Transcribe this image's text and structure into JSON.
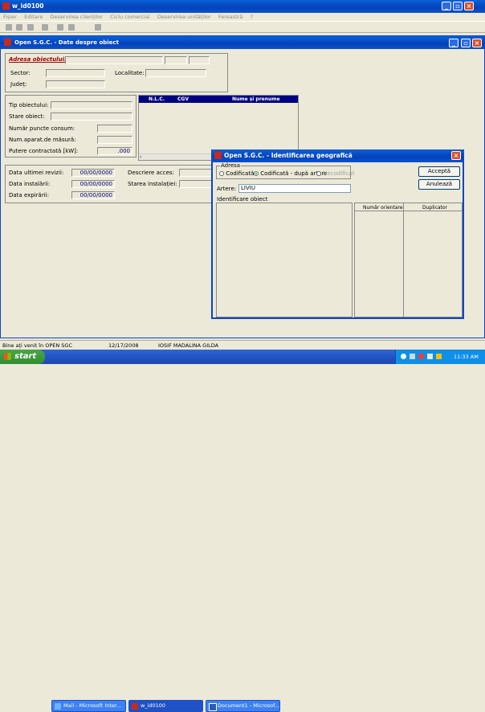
{
  "app": {
    "title": "w_id0100",
    "menu": [
      "Fișier",
      "Editare",
      "Deservirea clienților",
      "Ciclu comercial",
      "Deservirea unităților",
      "Fereastră",
      "?"
    ]
  },
  "child": {
    "title": "Open S.G.C. - Date despre obiect",
    "address": {
      "label": "Adresa obiectului:",
      "sector_label": "Sector:",
      "localitate_label": "Localitate:",
      "judet_label": "Județ:"
    },
    "object": {
      "tip_label": "Tip obiectului:",
      "stare_label": "Stare obiect:",
      "puncte_label": "Număr puncte consum:",
      "aparate_label": "Num.aparat.de măsură:",
      "putere_label": "Putere contractată [kW]:",
      "putere_value": ".000"
    },
    "owners_table": {
      "headers": [
        "N.L.C.",
        "CGV",
        "Nume și prenume"
      ]
    },
    "dates": {
      "revizie_label": "Data ultimei revizii:",
      "revizie_value": "00/00/0000",
      "instalare_label": "Data instalării:",
      "instalare_value": "00/00/0000",
      "expirare_label": "Data expirării:",
      "expirare_value": "00/00/0000",
      "acces_label": "Descriere acces:",
      "stare_inst_label": "Starea instalației:"
    }
  },
  "dialog": {
    "title": "Open S.G.C. - Identificarea geografică",
    "group_label": "Adresa",
    "radios": [
      {
        "label": "Codificată",
        "checked": false,
        "enabled": true
      },
      {
        "label": "Codificată - după artere",
        "checked": true,
        "enabled": true
      },
      {
        "label": "Necodificat",
        "checked": false,
        "enabled": false
      }
    ],
    "artere_label": "Artere:",
    "artere_value": "LIVIU",
    "ident_label": "Identificare obiect",
    "accept_label": "Acceptă",
    "cancel_label": "Anulează",
    "grid_headers": [
      "Număr orientare",
      "Duplicator"
    ]
  },
  "status": {
    "message": "Bine ați venit în OPEN SGC",
    "date": "12/17/2008",
    "user": "IOSIF MADALINA GILDA"
  },
  "taskbar": {
    "start_label": "start",
    "tasks": [
      {
        "label": "Mail - Microsoft Inter...",
        "active": false
      },
      {
        "label": "w_id0100",
        "active": true
      },
      {
        "label": "Document1 - Microsof...",
        "active": false
      }
    ],
    "time": "11:33 AM"
  }
}
